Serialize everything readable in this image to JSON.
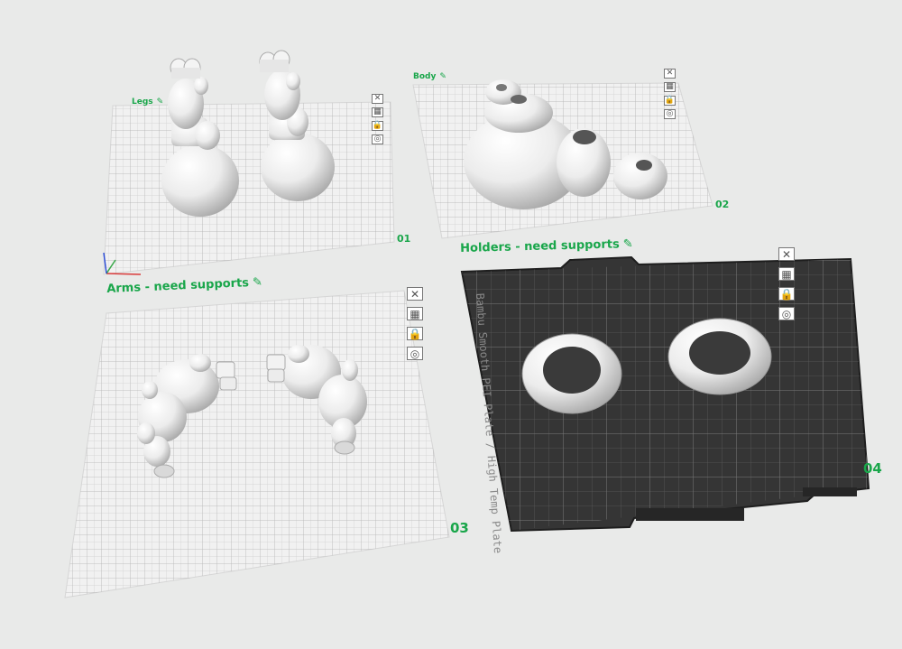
{
  "plates": [
    {
      "name": "Legs",
      "number": "01",
      "edit_icon": "✎"
    },
    {
      "name": "Body",
      "number": "02",
      "edit_icon": "✎"
    },
    {
      "name": "Arms - need supports",
      "number": "03",
      "edit_icon": "✎"
    },
    {
      "name": "Holders  - need supports",
      "number": "04",
      "edit_icon": "✎"
    }
  ],
  "plate_tools": {
    "delete": "✕",
    "arrange": "▦",
    "lock": "🔒",
    "settings": "◎"
  },
  "build_plate_label": "Bambu Smooth PEI Plate / High Temp Plate",
  "axis_colors": {
    "x": "#d93a3a",
    "y": "#3aa84a",
    "z": "#2f4fd6"
  },
  "accent_color": "#19a64a"
}
